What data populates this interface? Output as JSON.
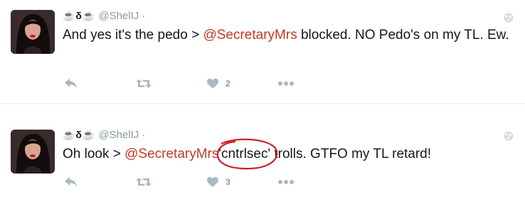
{
  "tweets": [
    {
      "display_name": "☕δ☕",
      "handle": "@ShelIJ",
      "separator": "·",
      "text_before": "And yes it's the pedo > ",
      "mention": "@SecretaryMrs",
      "text_after": " blocked. NO Pedo's on my TL. Ew.",
      "like_count": "2"
    },
    {
      "display_name": "☕δ☕",
      "handle": "@ShelIJ",
      "separator": "·",
      "text_before": "Oh look > ",
      "mention": "@SecretaryMrs",
      "circled_text": "'cntrlsec'",
      "text_after": " trolls. GTFO my TL retard!",
      "like_count": "3"
    }
  ],
  "icons": {
    "privacy": "globe-icon",
    "reply": "reply-icon",
    "retweet": "retweet-icon",
    "like": "heart-icon",
    "more": "more-dots-icon"
  },
  "colors": {
    "mention": "#c0392b",
    "icon": "#aab8c2",
    "annotation": "#d0202a"
  }
}
